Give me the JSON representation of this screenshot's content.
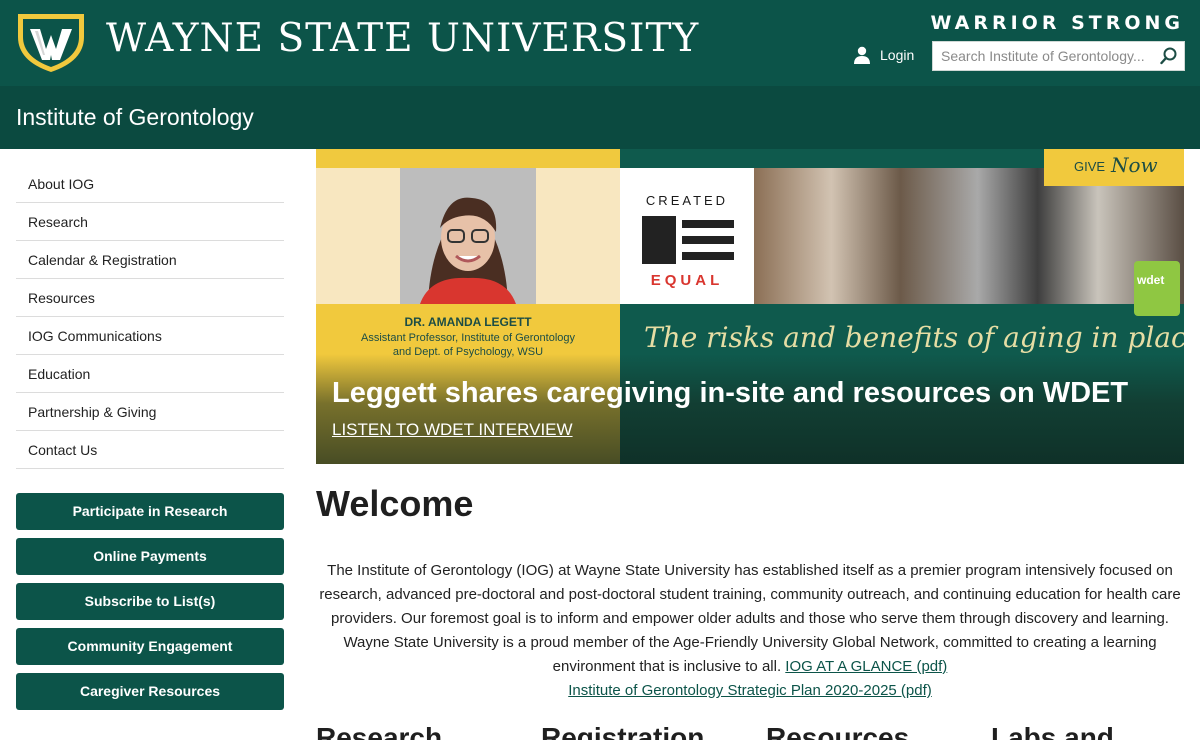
{
  "header": {
    "university": "WAYNE STATE UNIVERSITY",
    "tagline": "WARRIOR STRONG",
    "login_label": "Login",
    "search_placeholder": "Search Institute of Gerontology..."
  },
  "subheader": {
    "title": "Institute of Gerontology"
  },
  "sidebar": {
    "items": [
      {
        "label": "About IOG"
      },
      {
        "label": "Research"
      },
      {
        "label": "Calendar & Registration"
      },
      {
        "label": "Resources"
      },
      {
        "label": "IOG Communications"
      },
      {
        "label": "Education"
      },
      {
        "label": "Partnership & Giving"
      },
      {
        "label": "Contact Us"
      }
    ],
    "buttons": [
      {
        "label": "Participate in Research"
      },
      {
        "label": "Online Payments"
      },
      {
        "label": "Subscribe to List(s)"
      },
      {
        "label": "Community Engagement"
      },
      {
        "label": "Caregiver Resources"
      }
    ]
  },
  "hero": {
    "person_name": "DR. AMANDA LEGETT",
    "person_role_1": "Assistant Professor, Institute of Gerontology",
    "person_role_2": "and Dept. of Psychology, WSU",
    "created_top": "CREATED",
    "created_bottom": "EQUAL",
    "give_label": "GIVE",
    "give_now": "Now",
    "wdet_label": "wdet",
    "tagline": "The risks and benefits of aging in place",
    "headline": "Leggett shares caregiving in-site and resources on WDET",
    "cta": "LISTEN TO WDET INTERVIEW"
  },
  "main": {
    "title": "Welcome",
    "intro": "The Institute of Gerontology (IOG) at Wayne State University has established itself as a premier program intensively focused on research, advanced pre-doctoral and post-doctoral student training, community outreach, and continuing education for health care providers. Our foremost goal is to inform and empower older adults and those who serve them through discovery and learning. Wayne State University is a proud member of the Age-Friendly University Global Network, committed to creating a learning environment that is inclusive to all.",
    "link_glance": "IOG AT A GLANCE (pdf)",
    "link_plan": "Institute of Gerontology Strategic Plan 2020-2025 (pdf)",
    "columns": [
      "Research",
      "Registration",
      "Resources",
      "Labs and"
    ]
  },
  "colors": {
    "primary": "#0c5449",
    "sub": "#0b4a40",
    "gold": "#f1c93d"
  }
}
